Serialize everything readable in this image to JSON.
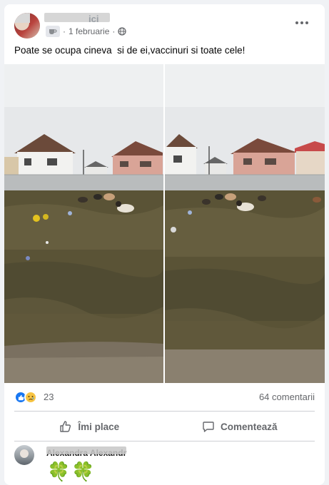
{
  "post": {
    "author_name": "...",
    "author_name_tail": "ici",
    "date": "1 februarie",
    "separator": "·",
    "text": "Poate se ocupa cineva  si de ei,vaccinuri si toate cele!"
  },
  "icons": {
    "group": "coffee-cup-icon",
    "audience": "globe-icon",
    "more": "ellipsis-icon",
    "like_reaction": "like-reaction-icon",
    "sad_reaction": "sad-reaction-icon",
    "like_button": "thumbs-up-icon",
    "comment_button": "comment-bubble-icon"
  },
  "stats": {
    "reaction_count": "23",
    "comments_label": "64 comentarii"
  },
  "actions": {
    "like_label": "Îmi place",
    "comment_label": "Comentează"
  },
  "comment": {
    "author": "Alexandra Alexandr",
    "content": "🍀🍀"
  },
  "colors": {
    "like_blue": "#1877f2",
    "sad_yellow": "#f7c443",
    "secondary_text": "#65676b",
    "background": "#f0f2f5"
  }
}
